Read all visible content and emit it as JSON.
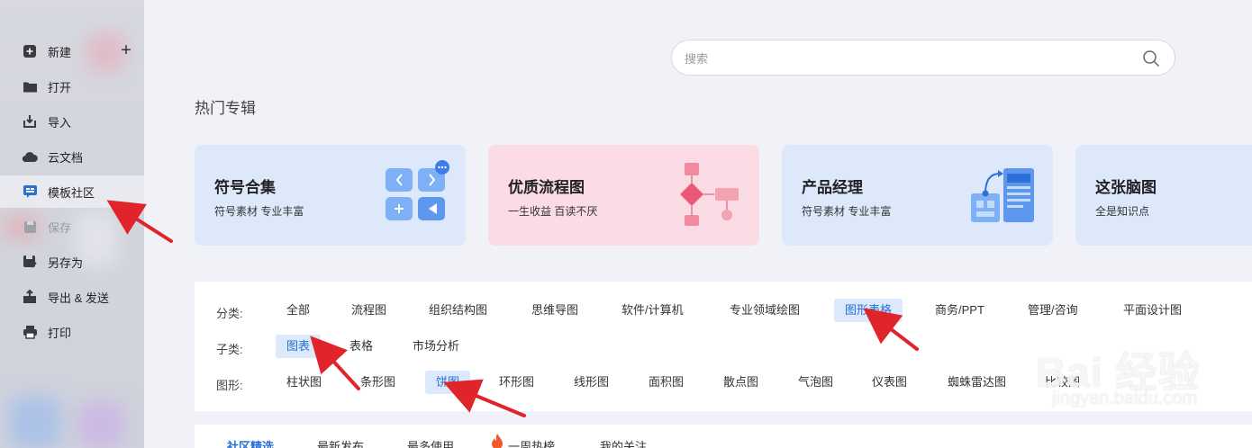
{
  "sidebar": {
    "items": [
      {
        "label": "新建",
        "icon": "plus-square-icon"
      },
      {
        "label": "打开",
        "icon": "folder-icon"
      },
      {
        "label": "导入",
        "icon": "import-icon"
      },
      {
        "label": "云文档",
        "icon": "cloud-icon"
      },
      {
        "label": "模板社区",
        "icon": "template-community-icon"
      },
      {
        "label": "保存",
        "icon": "save-icon"
      },
      {
        "label": "另存为",
        "icon": "save-as-icon"
      },
      {
        "label": "导出 & 发送",
        "icon": "export-icon"
      },
      {
        "label": "打印",
        "icon": "printer-icon"
      }
    ],
    "active_index": 4,
    "new_plus": "+"
  },
  "search": {
    "placeholder": "搜索"
  },
  "hot_albums": {
    "title": "热门专辑",
    "cards": [
      {
        "title": "符号合集",
        "subtitle": "符号素材 专业丰富",
        "bg": "#dde9fb"
      },
      {
        "title": "优质流程图",
        "subtitle": "一生收益 百读不厌",
        "bg": "#fbdce4"
      },
      {
        "title": "产品经理",
        "subtitle": "符号素材 专业丰富",
        "bg": "#dde9fb"
      },
      {
        "title": "这张脑图",
        "subtitle": "全是知识点",
        "bg": "#dde9fb"
      }
    ]
  },
  "filters": {
    "category_label": "分类:",
    "categories": [
      "全部",
      "流程图",
      "组织结构图",
      "思维导图",
      "软件/计算机",
      "专业领域绘图",
      "图形表格",
      "商务/PPT",
      "管理/咨询",
      "平面设计图"
    ],
    "category_selected": 6,
    "subcategory_label": "子类:",
    "subcategories": [
      "图表",
      "表格",
      "市场分析"
    ],
    "subcategory_selected": 0,
    "shape_label": "图形:",
    "shapes": [
      "柱状图",
      "条形图",
      "饼图",
      "环形图",
      "线形图",
      "面积图",
      "散点图",
      "气泡图",
      "仪表图",
      "蜘蛛雷达图",
      "比较图"
    ],
    "shape_selected": 2
  },
  "tabs": [
    "社区精选",
    "最新发布",
    "最多使用",
    "一周热榜",
    "我的关注"
  ],
  "tab_selected": 0,
  "watermark": {
    "main": "Bai 经验",
    "sub": "jingyan.baidu.com"
  },
  "colors": {
    "accent": "#2a6fd6",
    "chip_selected_bg": "#dbe9fb",
    "arrow": "#e0242b",
    "flame": "#f05a28"
  }
}
